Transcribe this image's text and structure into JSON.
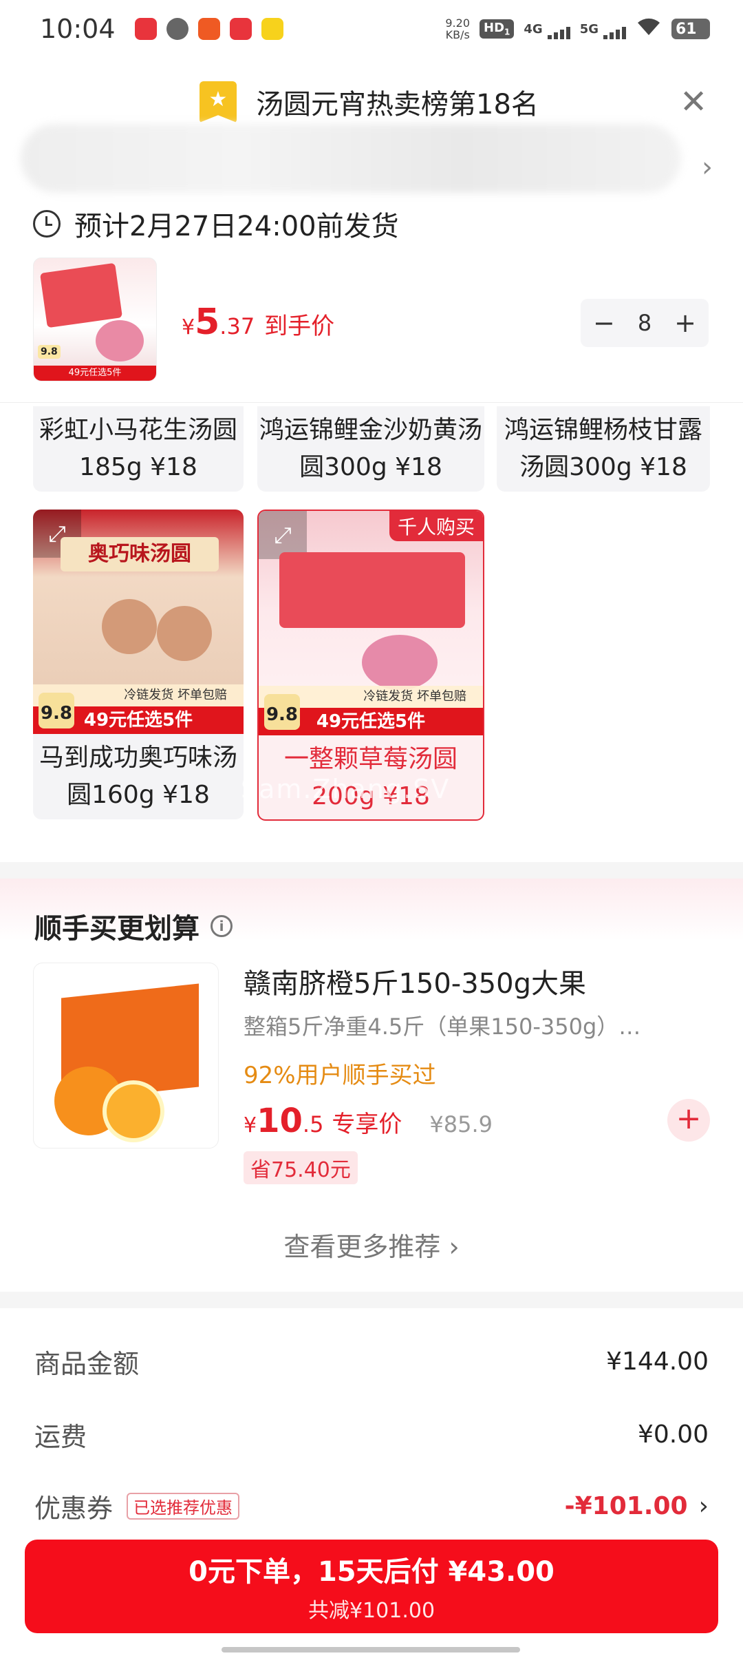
{
  "status_bar": {
    "time": "10:04",
    "speed_value": "9.20",
    "speed_unit": "KB/s",
    "hd": "HD",
    "hd_sub": "1",
    "net1": "4G",
    "net2": "5G",
    "battery": "61"
  },
  "ranking": {
    "label": "汤圆元宵热卖榜第18名",
    "icon": "star-bookmark-icon"
  },
  "shipping": {
    "text": "预计2月27日24:00前发货"
  },
  "cart_item": {
    "thumb_band": "49元任选5件",
    "thumb_price": "9.8",
    "currency": "¥",
    "price_int": "5",
    "price_dec": ".37",
    "price_label": "到手价",
    "quantity": "8"
  },
  "grid": {
    "row1": [
      {
        "name": "彩虹小马花生汤圆185g ¥18"
      },
      {
        "name": "鸿运锦鲤金沙奶黄汤圆300g ¥18"
      },
      {
        "name": "鸿运锦鲤杨枝甘露汤圆300g ¥18"
      }
    ],
    "row2": [
      {
        "name": "马到成功奥巧味汤圆160g ¥18",
        "strip": "冷链发货 坏单包赔",
        "band": "49元任选5件",
        "act": "9.8",
        "title": "奥巧味汤圆"
      },
      {
        "name": "一整颗草莓汤圆200g ¥18",
        "strip": "冷链发货 坏单包赔",
        "band": "49元任选5件",
        "act": "9.8",
        "hot": "千人购买"
      }
    ],
    "watermark": "Sam.Zhang.SV"
  },
  "recommend": {
    "title": "顺手买更划算",
    "name": "赣南脐橙5斤150-350g大果",
    "desc": "整箱5斤净重4.5斤（单果150-350g）…",
    "bought": "92%用户顺手买过",
    "currency": "¥",
    "price_int": "10",
    "price_dec": ".5",
    "price_label": "专享价",
    "orig_price": "¥85.9",
    "save": "省75.40元",
    "more": "查看更多推荐 ›"
  },
  "summary": {
    "goods_label": "商品金额",
    "goods_value": "¥144.00",
    "freight_label": "运费",
    "freight_value": "¥0.00",
    "coupon_label": "优惠券",
    "coupon_tag": "已选推荐优惠",
    "coupon_value": "-¥101.00"
  },
  "pay": {
    "main": "0元下单，15天后付 ¥43.00",
    "sub": "共减¥101.00"
  },
  "colors": {
    "accent_red": "#f50d1b",
    "price_red": "#e4202a",
    "orange_text": "#e58b13",
    "badge_yellow": "#f7c321"
  }
}
